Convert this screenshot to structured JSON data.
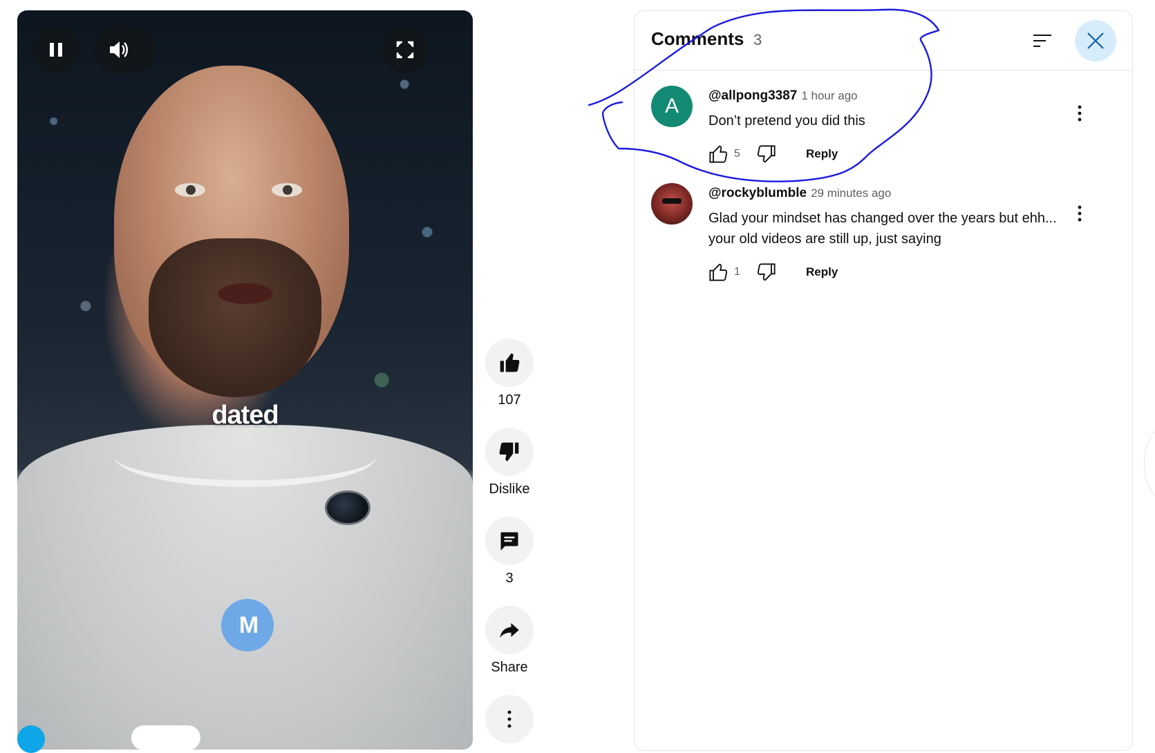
{
  "player": {
    "caption": "dated",
    "logo_text": "M",
    "controls": {
      "pause_icon": "pause-icon",
      "volume_icon": "volume-icon",
      "fullscreen_icon": "fullscreen-icon"
    }
  },
  "actions": {
    "like": {
      "icon": "thumb-up-icon",
      "label": "107"
    },
    "dislike": {
      "icon": "thumb-down-icon",
      "label": "Dislike"
    },
    "comments": {
      "icon": "comment-icon",
      "label": "3"
    },
    "share": {
      "icon": "share-icon",
      "label": "Share"
    },
    "more": {
      "icon": "more-vertical-icon"
    }
  },
  "comments_panel": {
    "title": "Comments",
    "count": "3",
    "sort_icon": "sort-icon",
    "close_icon": "close-icon",
    "accent_color": "#d6ecfb",
    "comments": [
      {
        "avatar_letter": "A",
        "avatar_color": "#138a73",
        "author": "@allpong3387",
        "time": "1 hour ago",
        "text": "Don’t pretend you did this",
        "likes": "5",
        "reply_label": "Reply"
      },
      {
        "avatar_letter": "",
        "author": "@rockyblumble",
        "time": "29 minutes ago",
        "text": "Glad your mindset has changed over the years but ehh... your old videos are still up, just saying",
        "likes": "1",
        "reply_label": "Reply"
      }
    ]
  },
  "annotation_color": "#1a1adf"
}
